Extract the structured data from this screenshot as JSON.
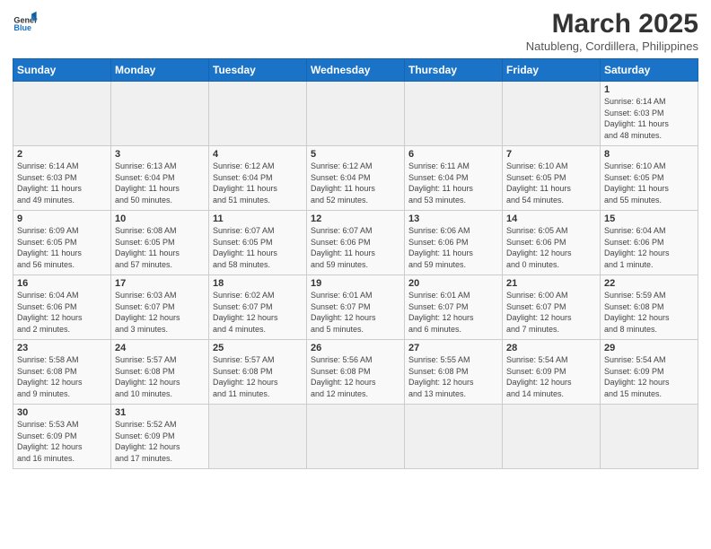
{
  "header": {
    "logo_general": "General",
    "logo_blue": "Blue",
    "month": "March 2025",
    "location": "Natubleng, Cordillera, Philippines"
  },
  "days_of_week": [
    "Sunday",
    "Monday",
    "Tuesday",
    "Wednesday",
    "Thursday",
    "Friday",
    "Saturday"
  ],
  "weeks": [
    [
      {
        "day": "",
        "info": ""
      },
      {
        "day": "",
        "info": ""
      },
      {
        "day": "",
        "info": ""
      },
      {
        "day": "",
        "info": ""
      },
      {
        "day": "",
        "info": ""
      },
      {
        "day": "",
        "info": ""
      },
      {
        "day": "1",
        "info": "Sunrise: 6:14 AM\nSunset: 6:03 PM\nDaylight: 11 hours\nand 48 minutes."
      }
    ],
    [
      {
        "day": "2",
        "info": "Sunrise: 6:14 AM\nSunset: 6:03 PM\nDaylight: 11 hours\nand 49 minutes."
      },
      {
        "day": "3",
        "info": "Sunrise: 6:13 AM\nSunset: 6:04 PM\nDaylight: 11 hours\nand 50 minutes."
      },
      {
        "day": "4",
        "info": "Sunrise: 6:12 AM\nSunset: 6:04 PM\nDaylight: 11 hours\nand 51 minutes."
      },
      {
        "day": "5",
        "info": "Sunrise: 6:12 AM\nSunset: 6:04 PM\nDaylight: 11 hours\nand 52 minutes."
      },
      {
        "day": "6",
        "info": "Sunrise: 6:11 AM\nSunset: 6:04 PM\nDaylight: 11 hours\nand 53 minutes."
      },
      {
        "day": "7",
        "info": "Sunrise: 6:10 AM\nSunset: 6:05 PM\nDaylight: 11 hours\nand 54 minutes."
      },
      {
        "day": "8",
        "info": "Sunrise: 6:10 AM\nSunset: 6:05 PM\nDaylight: 11 hours\nand 55 minutes."
      }
    ],
    [
      {
        "day": "9",
        "info": "Sunrise: 6:09 AM\nSunset: 6:05 PM\nDaylight: 11 hours\nand 56 minutes."
      },
      {
        "day": "10",
        "info": "Sunrise: 6:08 AM\nSunset: 6:05 PM\nDaylight: 11 hours\nand 57 minutes."
      },
      {
        "day": "11",
        "info": "Sunrise: 6:07 AM\nSunset: 6:05 PM\nDaylight: 11 hours\nand 58 minutes."
      },
      {
        "day": "12",
        "info": "Sunrise: 6:07 AM\nSunset: 6:06 PM\nDaylight: 11 hours\nand 59 minutes."
      },
      {
        "day": "13",
        "info": "Sunrise: 6:06 AM\nSunset: 6:06 PM\nDaylight: 11 hours\nand 59 minutes."
      },
      {
        "day": "14",
        "info": "Sunrise: 6:05 AM\nSunset: 6:06 PM\nDaylight: 12 hours\nand 0 minutes."
      },
      {
        "day": "15",
        "info": "Sunrise: 6:04 AM\nSunset: 6:06 PM\nDaylight: 12 hours\nand 1 minute."
      }
    ],
    [
      {
        "day": "16",
        "info": "Sunrise: 6:04 AM\nSunset: 6:06 PM\nDaylight: 12 hours\nand 2 minutes."
      },
      {
        "day": "17",
        "info": "Sunrise: 6:03 AM\nSunset: 6:07 PM\nDaylight: 12 hours\nand 3 minutes."
      },
      {
        "day": "18",
        "info": "Sunrise: 6:02 AM\nSunset: 6:07 PM\nDaylight: 12 hours\nand 4 minutes."
      },
      {
        "day": "19",
        "info": "Sunrise: 6:01 AM\nSunset: 6:07 PM\nDaylight: 12 hours\nand 5 minutes."
      },
      {
        "day": "20",
        "info": "Sunrise: 6:01 AM\nSunset: 6:07 PM\nDaylight: 12 hours\nand 6 minutes."
      },
      {
        "day": "21",
        "info": "Sunrise: 6:00 AM\nSunset: 6:07 PM\nDaylight: 12 hours\nand 7 minutes."
      },
      {
        "day": "22",
        "info": "Sunrise: 5:59 AM\nSunset: 6:08 PM\nDaylight: 12 hours\nand 8 minutes."
      }
    ],
    [
      {
        "day": "23",
        "info": "Sunrise: 5:58 AM\nSunset: 6:08 PM\nDaylight: 12 hours\nand 9 minutes."
      },
      {
        "day": "24",
        "info": "Sunrise: 5:57 AM\nSunset: 6:08 PM\nDaylight: 12 hours\nand 10 minutes."
      },
      {
        "day": "25",
        "info": "Sunrise: 5:57 AM\nSunset: 6:08 PM\nDaylight: 12 hours\nand 11 minutes."
      },
      {
        "day": "26",
        "info": "Sunrise: 5:56 AM\nSunset: 6:08 PM\nDaylight: 12 hours\nand 12 minutes."
      },
      {
        "day": "27",
        "info": "Sunrise: 5:55 AM\nSunset: 6:08 PM\nDaylight: 12 hours\nand 13 minutes."
      },
      {
        "day": "28",
        "info": "Sunrise: 5:54 AM\nSunset: 6:09 PM\nDaylight: 12 hours\nand 14 minutes."
      },
      {
        "day": "29",
        "info": "Sunrise: 5:54 AM\nSunset: 6:09 PM\nDaylight: 12 hours\nand 15 minutes."
      }
    ],
    [
      {
        "day": "30",
        "info": "Sunrise: 5:53 AM\nSunset: 6:09 PM\nDaylight: 12 hours\nand 16 minutes."
      },
      {
        "day": "31",
        "info": "Sunrise: 5:52 AM\nSunset: 6:09 PM\nDaylight: 12 hours\nand 17 minutes."
      },
      {
        "day": "",
        "info": ""
      },
      {
        "day": "",
        "info": ""
      },
      {
        "day": "",
        "info": ""
      },
      {
        "day": "",
        "info": ""
      },
      {
        "day": "",
        "info": ""
      }
    ]
  ]
}
